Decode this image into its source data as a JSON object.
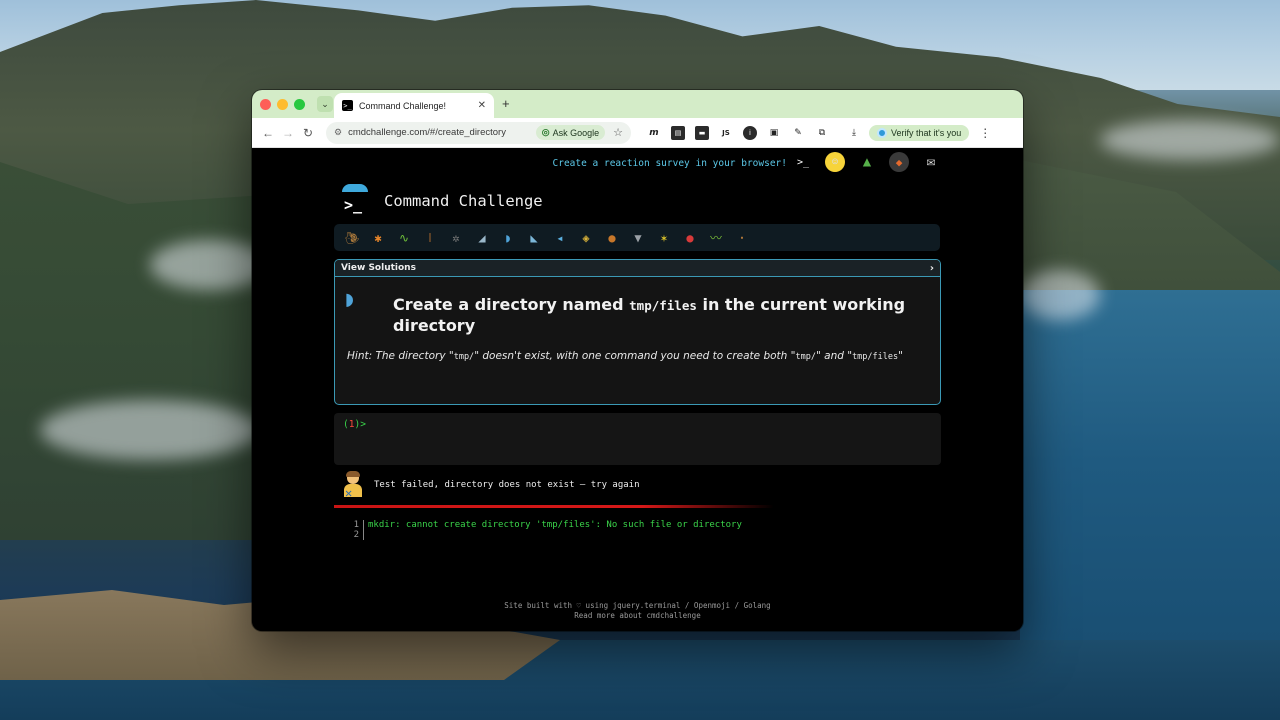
{
  "browser": {
    "tab_title": "Command Challenge!",
    "tab_favicon": ">_",
    "new_tab_symbol": "+",
    "tab_close_symbol": "✕",
    "dropdown_symbol": "⌄",
    "url": "cmdchallenge.com/#/create_directory",
    "ask_google_label": "Ask Google",
    "verify_label": "Verify that it's you"
  },
  "header": {
    "promo_text": "Create a reaction survey in your browser!",
    "brand_title": "Command Challenge"
  },
  "challenge_icons": [
    "snail-icon",
    "butterfly-icon",
    "caterpillar-icon",
    "bug-icon",
    "gear-bug-icon",
    "shark-icon",
    "whale-icon",
    "dolphin-icon",
    "fish-icon",
    "tropical-fish-icon",
    "turtle-icon",
    "wolf-icon",
    "bee-icon",
    "ladybug-icon",
    "worm-icon",
    "ant-icon"
  ],
  "card": {
    "view_solutions": "View Solutions",
    "chevron": "›",
    "title_prefix": "Create a directory named",
    "title_code": "tmp/files",
    "title_suffix": "in the current working directory",
    "hint_part1": "Hint: The directory \"",
    "hint_code1": "tmp/",
    "hint_part2": "\" doesn't exist, with one command you need to create both \"",
    "hint_code2": "tmp/",
    "hint_part3": "\" and \"",
    "hint_code3": "tmp/files",
    "hint_part4": "\""
  },
  "terminal": {
    "prompt_open": "(",
    "prompt_number": "1",
    "prompt_close": ")>"
  },
  "result": {
    "message": "Test failed, directory does not exist – try again"
  },
  "output": {
    "lines": [
      {
        "num": "1",
        "text": "mkdir: cannot create directory 'tmp/files': No such file or directory"
      },
      {
        "num": "2",
        "text": ""
      }
    ]
  },
  "footer": {
    "line1": "Site built with ♡ using jquery.terminal / Openmoji / Golang",
    "line2": "Read more about cmdchallenge"
  },
  "colors": {
    "accent_cyan": "#3b99b5",
    "prompt_green": "#3ad34a",
    "error_red": "#d51818",
    "tab_bar": "#d4ecc8"
  }
}
